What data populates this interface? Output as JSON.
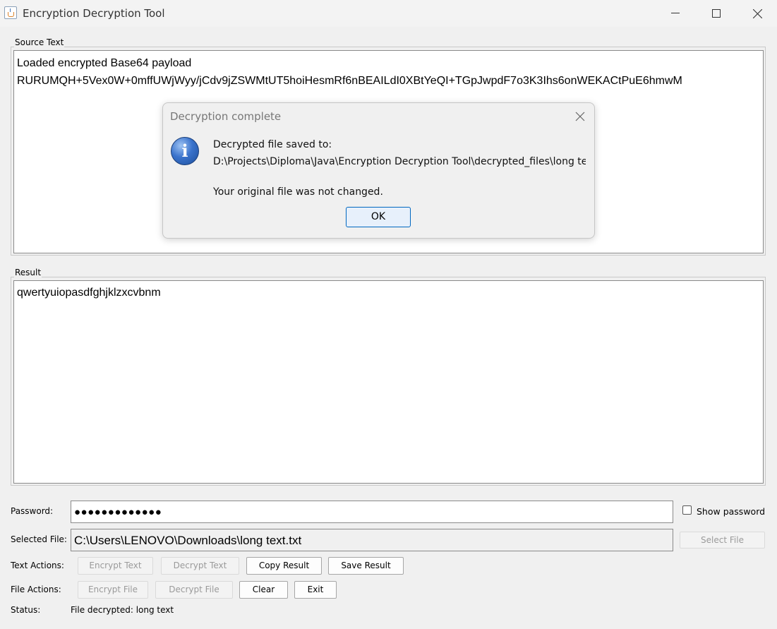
{
  "window": {
    "title": "Encryption Decryption Tool",
    "icon": "java-cup-icon"
  },
  "source": {
    "label": "Source Text",
    "lines": [
      "Loaded encrypted Base64 payload",
      "RURUMQH+5Vex0W+0mffUWjWyy/jCdv9jZSWMtUT5hoiHesmRf6nBEAILdI0XBtYeQI+TGpJwpdF7o3K3Ihs6onWEKACtPuE6hmwM"
    ]
  },
  "result": {
    "label": "Result",
    "text": "qwertyuiopasdfghjklzxcvbnm"
  },
  "password": {
    "label": "Password:",
    "value": "●●●●●●●●●●●●●",
    "show_label": "Show password",
    "show_checked": false
  },
  "file": {
    "label": "Selected File:",
    "value": "C:\\Users\\LENOVO\\Downloads\\long text.txt",
    "select_label": "Select File"
  },
  "text_actions": {
    "label": "Text Actions:",
    "encrypt": "Encrypt Text",
    "decrypt": "Decrypt Text",
    "copy": "Copy Result",
    "save": "Save Result"
  },
  "file_actions": {
    "label": "File Actions:",
    "encrypt": "Encrypt File",
    "decrypt": "Decrypt File",
    "clear": "Clear",
    "exit": "Exit"
  },
  "status": {
    "label": "Status:",
    "value": "File decrypted: long text"
  },
  "dialog": {
    "title": "Decryption complete",
    "line1": "Decrypted file saved to:",
    "line2": "D:\\Projects\\Diploma\\Java\\Encryption Decryption Tool\\decrypted_files\\long text",
    "line3": "Your original file was not changed.",
    "ok": "OK"
  },
  "colors": {
    "accent": "#0067c0",
    "window_bg": "#f0f0f0",
    "disabled_text": "#9a9a9a"
  }
}
